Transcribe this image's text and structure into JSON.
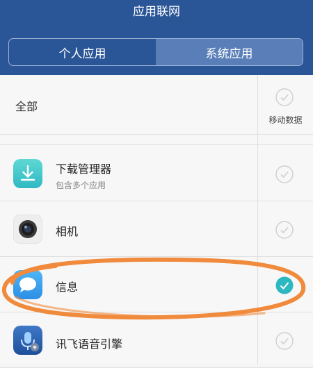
{
  "header": {
    "title": "应用联网"
  },
  "tabs": [
    {
      "label": "个人应用",
      "active": false
    },
    {
      "label": "系统应用",
      "active": true
    }
  ],
  "all_row": {
    "label": "全部",
    "column_label": "移动数据",
    "checked": false
  },
  "apps": [
    {
      "name": "下载管理器",
      "subtitle": "包含多个应用",
      "icon": "download-icon",
      "checked": false
    },
    {
      "name": "相机",
      "icon": "camera-icon",
      "checked": false
    },
    {
      "name": "信息",
      "icon": "message-icon",
      "checked": true
    },
    {
      "name": "讯飞语音引擎",
      "icon": "voice-engine-icon",
      "checked": false
    }
  ],
  "colors": {
    "header_bg": "#2a5596",
    "active_tab_bg": "#5a7fb8",
    "check_active": "#2db7c0",
    "check_inactive": "#cfcfcf",
    "annotation": "#f08a3c"
  }
}
